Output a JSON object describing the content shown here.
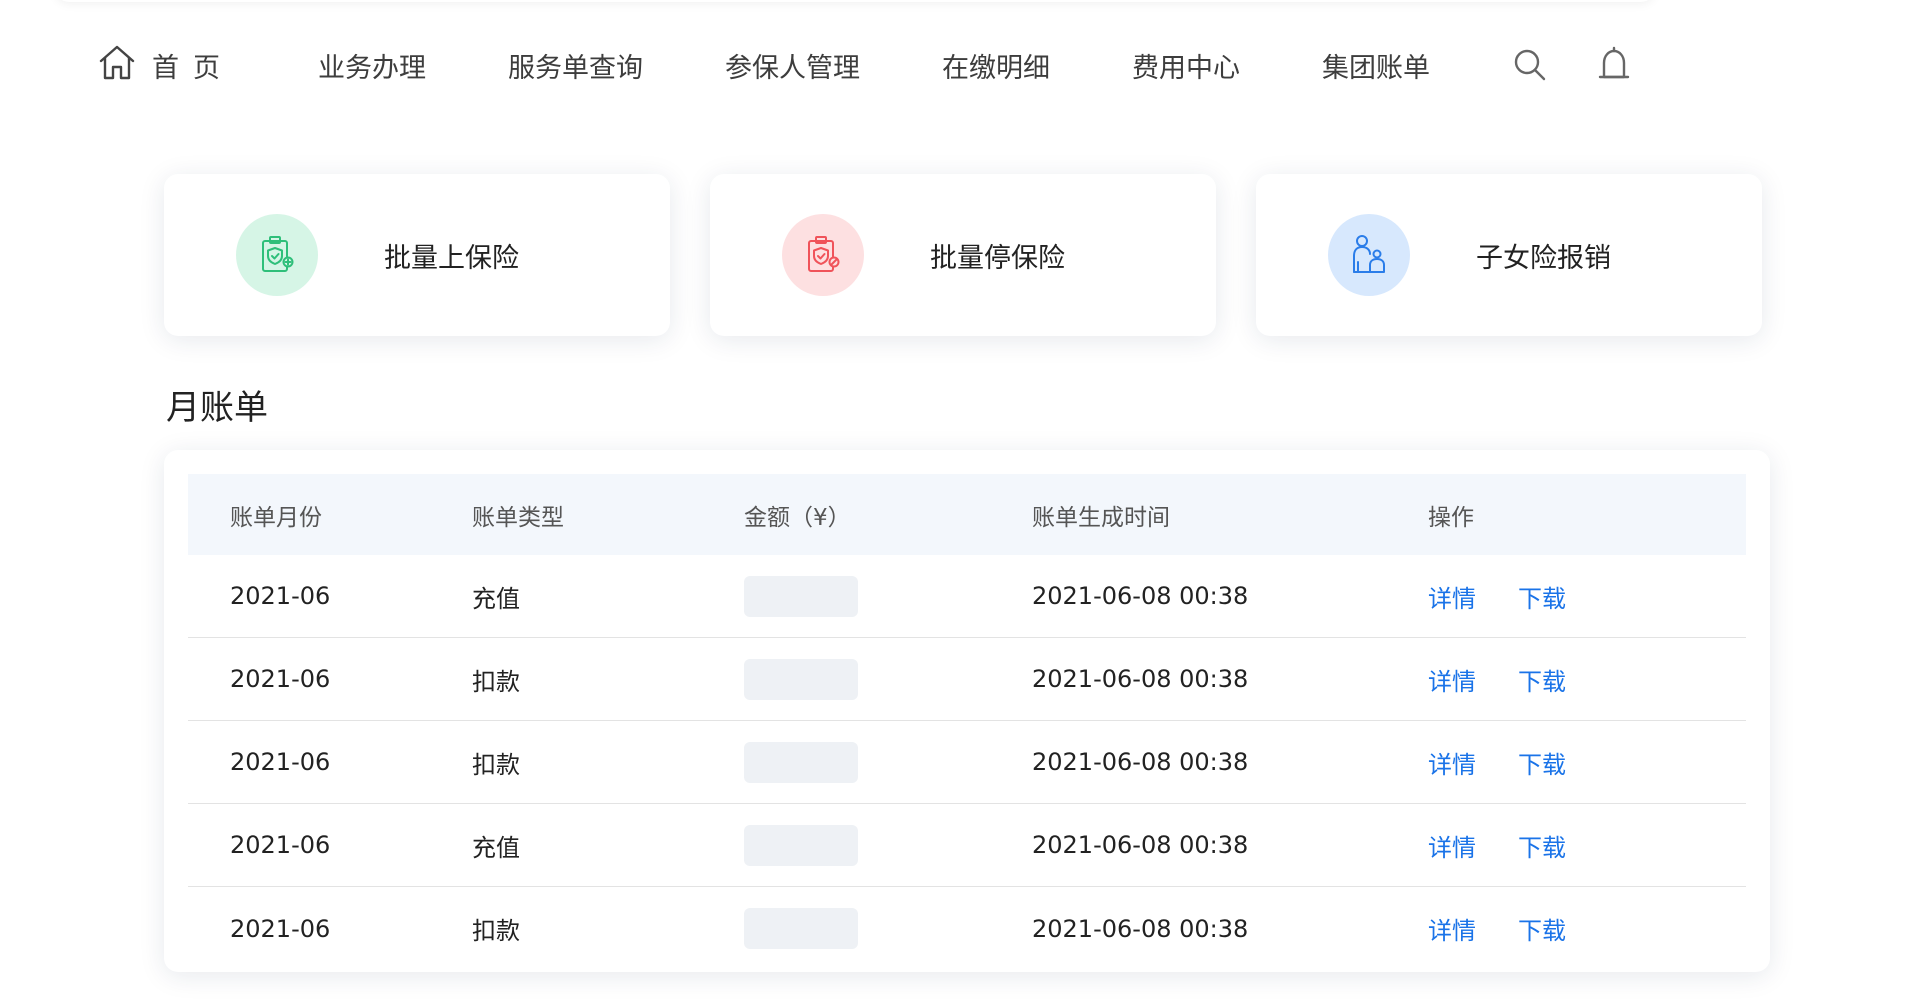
{
  "nav": {
    "home": "首页",
    "links": [
      "业务办理",
      "服务单查询",
      "参保人管理",
      "在缴明细",
      "费用中心",
      "集团账单"
    ],
    "icons": [
      "search-icon",
      "bell-icon"
    ]
  },
  "cards": [
    {
      "label": "批量上保险",
      "icon": "clipboard-shield-plus-icon",
      "color": "#2fbf7a"
    },
    {
      "label": "批量停保险",
      "icon": "clipboard-shield-stop-icon",
      "color": "#f0535a"
    },
    {
      "label": "子女险报销",
      "icon": "parent-child-icon",
      "color": "#2b7de9"
    }
  ],
  "bills": {
    "title": "月账单",
    "columns": [
      "账单月份",
      "账单类型",
      "金额（¥）",
      "账单生成时间",
      "操作"
    ],
    "actions": {
      "detail": "详情",
      "download": "下载"
    },
    "rows": [
      {
        "month": "2021-06",
        "type": "充值",
        "time": "2021-06-08 00:38"
      },
      {
        "month": "2021-06",
        "type": "扣款",
        "time": "2021-06-08 00:38"
      },
      {
        "month": "2021-06",
        "type": "扣款",
        "time": "2021-06-08 00:38"
      },
      {
        "month": "2021-06",
        "type": "充值",
        "time": "2021-06-08 00:38"
      },
      {
        "month": "2021-06",
        "type": "扣款",
        "time": "2021-06-08 00:38"
      }
    ]
  },
  "colors": {
    "link": "#1a73e8",
    "header_bg": "#f3f7fc",
    "mask": "#eef1f5"
  }
}
